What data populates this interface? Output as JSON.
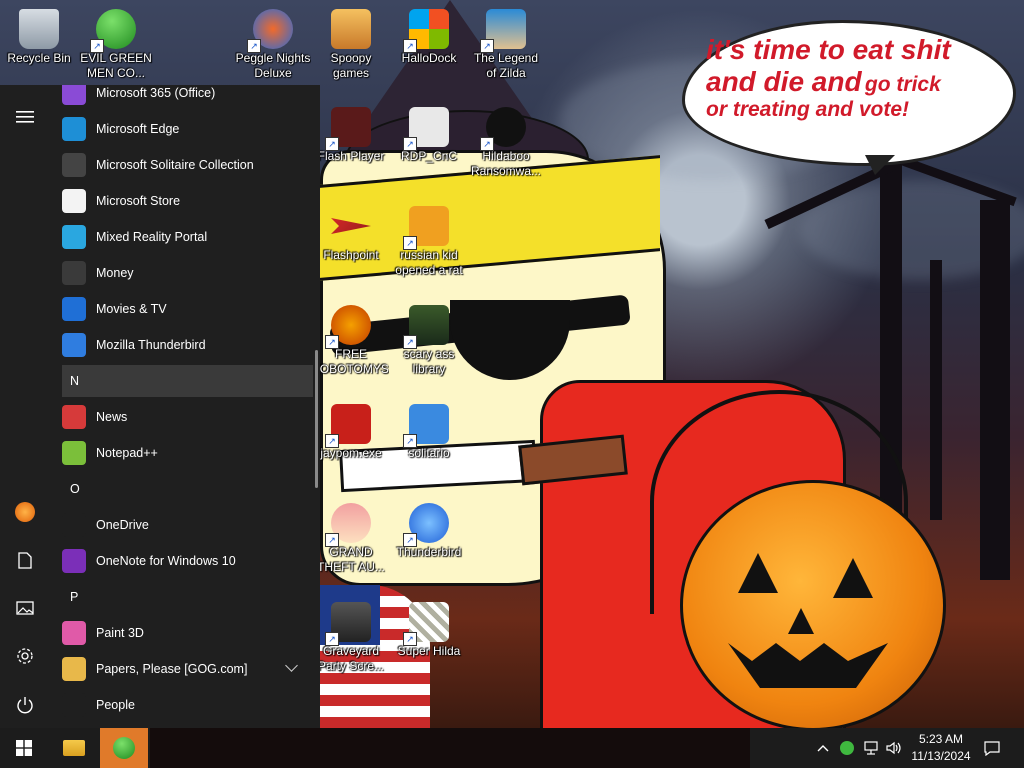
{
  "desktop": {
    "speech_bubble": {
      "line1": "it's time to eat shit",
      "line2a": "and die and",
      "line2b": "go trick",
      "line3": "or treating and vote!"
    },
    "icons": [
      {
        "label": "Recycle Bin",
        "icon": "recycle-bin-icon"
      },
      {
        "label": "EVIL GREEN MEN CO...",
        "icon": "green-men-icon"
      },
      {
        "label": "Peggle Nights Deluxe",
        "icon": "peggle-icon"
      },
      {
        "label": "Spoopy games",
        "icon": "folder-icon"
      },
      {
        "label": "HalloDock",
        "icon": "windows-shield-icon"
      },
      {
        "label": "The Legend of Zilda",
        "icon": "zilda-icon"
      },
      {
        "label": "Flash Player",
        "icon": "flash-icon"
      },
      {
        "label": "RDP_CnC",
        "icon": "rdp-icon"
      },
      {
        "label": "Hildaboo Ransomwa...",
        "icon": "yashma-icon"
      },
      {
        "label": "Flashpoint",
        "icon": "flashpoint-icon"
      },
      {
        "label": "russian kid opened a rat",
        "icon": "de-icon"
      },
      {
        "label": "FREE LOBOTOMYS",
        "icon": "lobotomy-icon"
      },
      {
        "label": "scary ass library",
        "icon": "library-icon"
      },
      {
        "label": "jaypom.exe",
        "icon": "flash-icon"
      },
      {
        "label": "solitario",
        "icon": "solitario-icon"
      },
      {
        "label": "GRAND THEFT AU...",
        "icon": "anime-girl-icon"
      },
      {
        "label": "Thunderbird",
        "icon": "thunderbird-icon"
      },
      {
        "label": "Graveyard Party Scre...",
        "icon": "graveyard-icon"
      },
      {
        "label": "Super Hilda",
        "icon": "super-hilda-icon"
      }
    ]
  },
  "start_menu": {
    "apps": [
      {
        "type": "app",
        "label": "Microsoft 365 (Office)",
        "icon": "office-icon",
        "color": "#8a4bd6"
      },
      {
        "type": "app",
        "label": "Microsoft Edge",
        "icon": "edge-icon",
        "color": "#1e8fd6"
      },
      {
        "type": "app",
        "label": "Microsoft Solitaire Collection",
        "icon": "cards-icon",
        "color": "#444444"
      },
      {
        "type": "app",
        "label": "Microsoft Store",
        "icon": "store-icon",
        "color": "#f3f3f3"
      },
      {
        "type": "app",
        "label": "Mixed Reality Portal",
        "icon": "headset-icon",
        "color": "#2aa7e0"
      },
      {
        "type": "app",
        "label": "Money",
        "icon": "money-chart-icon",
        "color": "#3a3a3a"
      },
      {
        "type": "app",
        "label": "Movies & TV",
        "icon": "movies-icon",
        "color": "#1f6fd6"
      },
      {
        "type": "app",
        "label": "Mozilla Thunderbird",
        "icon": "thunderbird-icon",
        "color": "#2f7de0"
      },
      {
        "type": "letter",
        "label": "N",
        "highlight": true
      },
      {
        "type": "app",
        "label": "News",
        "icon": "news-icon",
        "color": "#d63a3a"
      },
      {
        "type": "app",
        "label": "Notepad++",
        "icon": "notepad-plus-icon",
        "color": "#7bbf3a"
      },
      {
        "type": "letter",
        "label": "O",
        "highlight": false
      },
      {
        "type": "app",
        "label": "OneDrive",
        "icon": "onedrive-icon",
        "color": "#1f1f1f"
      },
      {
        "type": "app",
        "label": "OneNote for Windows 10",
        "icon": "onenote-icon",
        "color": "#7b2fb8"
      },
      {
        "type": "letter",
        "label": "P",
        "highlight": false
      },
      {
        "type": "app",
        "label": "Paint 3D",
        "icon": "paint3d-icon",
        "color": "#e05aa8"
      },
      {
        "type": "app",
        "label": "Papers, Please [GOG.com]",
        "icon": "folder-icon",
        "color": "#e8b84a",
        "expandable": true
      },
      {
        "type": "app",
        "label": "People",
        "icon": "people-icon",
        "color": "#1f1f1f"
      }
    ],
    "rail": [
      {
        "icon": "hamburger-menu-icon"
      },
      {
        "icon": "user-avatar-icon"
      },
      {
        "icon": "documents-icon"
      },
      {
        "icon": "pictures-icon"
      },
      {
        "icon": "settings-gear-icon"
      },
      {
        "icon": "power-icon"
      }
    ]
  },
  "taskbar": {
    "start_icon": "windows-logo-icon",
    "pinned": [
      {
        "icon": "file-explorer-icon"
      },
      {
        "icon": "green-men-icon",
        "active": true
      }
    ],
    "tray": {
      "chevron": "chevron-up-icon",
      "icons": [
        "green-men-tray-icon",
        "network-icon",
        "volume-icon"
      ],
      "time": "5:23 AM",
      "date": "11/13/2024",
      "notification": "notification-icon"
    }
  }
}
